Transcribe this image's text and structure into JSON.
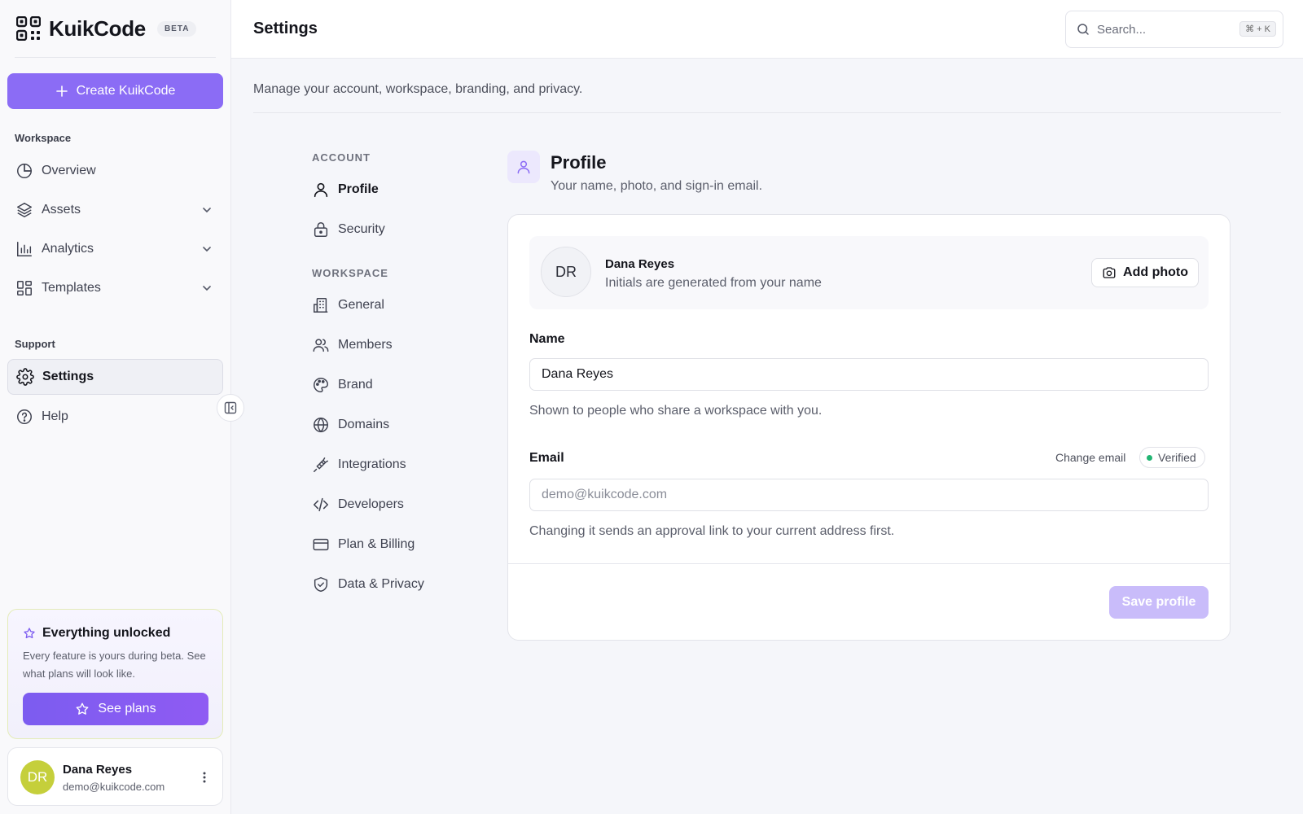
{
  "app": {
    "name": "KuikCode",
    "badge": "BETA"
  },
  "sidebar": {
    "create_label": "Create KuikCode",
    "workspace_label": "Workspace",
    "workspace_items": [
      {
        "label": "Overview",
        "icon": "pie-chart-icon"
      },
      {
        "label": "Assets",
        "icon": "layers-icon"
      },
      {
        "label": "Analytics",
        "icon": "bar-chart-icon"
      },
      {
        "label": "Templates",
        "icon": "layout-grid-icon"
      }
    ],
    "support_label": "Support",
    "support_items": [
      {
        "label": "Settings",
        "icon": "gear-icon",
        "active": true
      },
      {
        "label": "Help",
        "icon": "help-circle-icon"
      }
    ],
    "unlock": {
      "title": "Everything unlocked",
      "desc": "Every feature is yours during beta. See what plans will look like.",
      "button": "See plans"
    },
    "user": {
      "initials": "DR",
      "name": "Dana Reyes",
      "email": "demo@kuikcode.com"
    }
  },
  "header": {
    "title": "Settings",
    "search_placeholder": "Search...",
    "search_shortcut": "⌘ + K"
  },
  "page": {
    "subtitle": "Manage your account, workspace, branding, and privacy."
  },
  "settings_nav": {
    "account_label": "ACCOUNT",
    "account_items": [
      {
        "label": "Profile",
        "active": true
      },
      {
        "label": "Security"
      }
    ],
    "workspace_label": "WORKSPACE",
    "workspace_items": [
      {
        "label": "General"
      },
      {
        "label": "Members"
      },
      {
        "label": "Brand"
      },
      {
        "label": "Domains"
      },
      {
        "label": "Integrations"
      },
      {
        "label": "Developers"
      },
      {
        "label": "Plan & Billing"
      },
      {
        "label": "Data & Privacy"
      }
    ]
  },
  "profile": {
    "title": "Profile",
    "subtitle": "Your name, photo, and sign-in email.",
    "avatar_initials": "DR",
    "display_name": "Dana Reyes",
    "avatar_hint": "Initials are generated from your name",
    "add_photo": "Add photo",
    "name_label": "Name",
    "name_value": "Dana Reyes",
    "name_help": "Shown to people who share a workspace with you.",
    "email_label": "Email",
    "change_email": "Change email",
    "verified": "Verified",
    "email_value": "demo@kuikcode.com",
    "email_help": "Changing it sends an approval link to your current address first.",
    "save": "Save profile"
  },
  "colors": {
    "accent": "#8b6cf5",
    "verified": "#22b573",
    "avatar": "#c5cf3b"
  }
}
